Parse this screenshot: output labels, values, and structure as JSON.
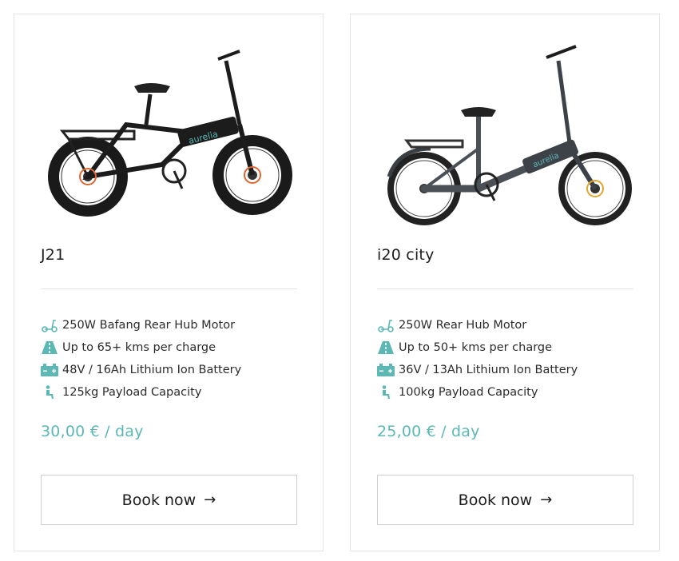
{
  "colors": {
    "accent": "#5bb8b5",
    "border": "#e6e6e6",
    "text": "#1f1f1f"
  },
  "products": [
    {
      "name": "J21",
      "image_icon": "fat-tire-folding-ebike-image",
      "features": [
        {
          "icon": "scooter-icon",
          "text": "250W Bafang Rear Hub Motor"
        },
        {
          "icon": "road-icon",
          "text": "Up to 65+ kms per charge"
        },
        {
          "icon": "battery-icon",
          "text": "48V / 16Ah Lithium Ion Battery"
        },
        {
          "icon": "seated-person-icon",
          "text": "125kg Payload Capacity"
        }
      ],
      "price": "30,00 € / day",
      "button_label": "Book now",
      "button_arrow": "→"
    },
    {
      "name": "i20 city",
      "image_icon": "city-folding-ebike-image",
      "features": [
        {
          "icon": "scooter-icon",
          "text": "250W Rear Hub Motor"
        },
        {
          "icon": "road-icon",
          "text": "Up to 50+ kms per charge"
        },
        {
          "icon": "battery-icon",
          "text": "36V / 13Ah Lithium Ion Battery"
        },
        {
          "icon": "seated-person-icon",
          "text": "100kg Payload Capacity"
        }
      ],
      "price": "25,00 € / day",
      "button_label": "Book now",
      "button_arrow": "→"
    }
  ]
}
